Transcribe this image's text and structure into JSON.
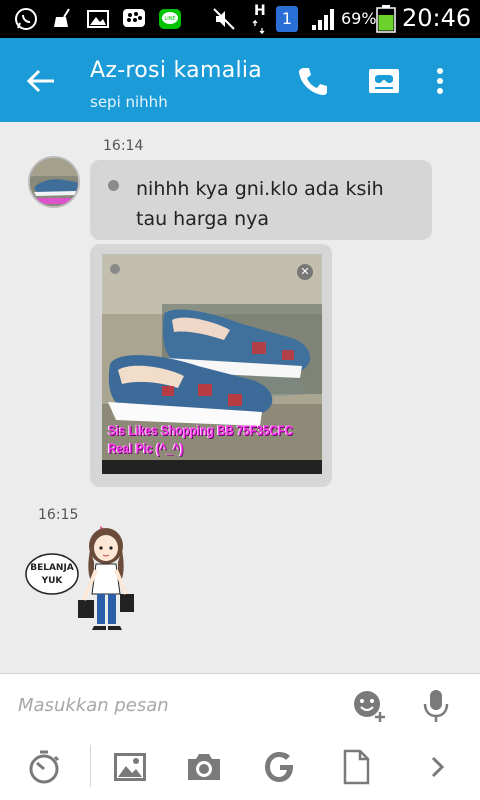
{
  "status_bar": {
    "battery_percent": "69%",
    "time": "20:46",
    "network": "H",
    "sim_badge": "1",
    "icons": [
      "whatsapp-icon",
      "sweep-icon",
      "gallery-icon",
      "bbm-icon",
      "line-icon",
      "mute-icon",
      "signal-icon",
      "battery-icon"
    ]
  },
  "header": {
    "contact_name": "Az-rosi kamalia",
    "status_message": "sepi nihhh",
    "actions": [
      "phone-icon",
      "video-call-icon",
      "more-icon"
    ]
  },
  "messages": [
    {
      "timestamp": "16:14",
      "text": "nihhh kya gni.klo ada ksih tau harga nya",
      "image_caption_line1": "Sis Likes Shopping BB 75F35CFC",
      "image_caption_line2": "Real Pic (^_^)"
    },
    {
      "timestamp": "16:15",
      "sticker_text_line1": "BELANJA",
      "sticker_text_line2": "YUK"
    }
  ],
  "composer": {
    "placeholder": "Masukkan pesan"
  },
  "colors": {
    "app_bar": "#1b9bd7",
    "bubble": "#d6d6d6",
    "background": "#ececec"
  }
}
